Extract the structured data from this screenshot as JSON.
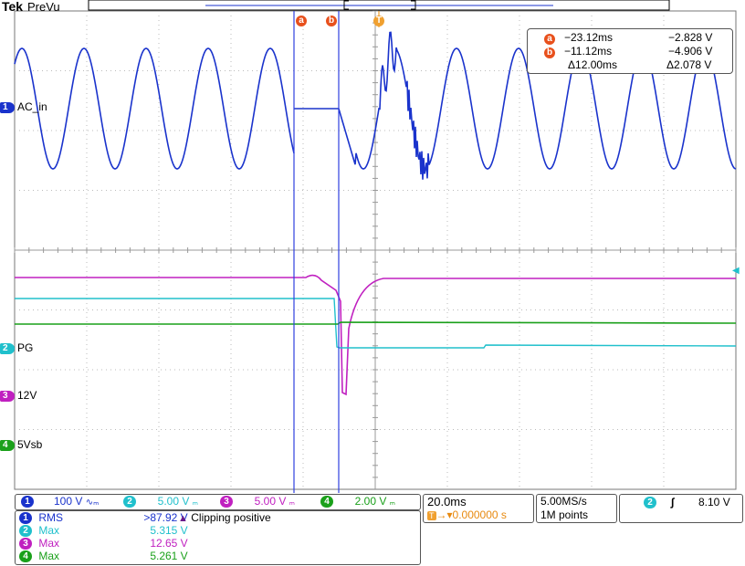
{
  "header": {
    "brand": "Tek",
    "mode": "PreVu"
  },
  "cursors": {
    "a": {
      "label": "a",
      "time": "−23.12ms",
      "volt": "−2.828 V"
    },
    "b": {
      "label": "b",
      "time": "−11.12ms",
      "volt": "−4.906 V"
    },
    "delta": {
      "time": "Δ12.00ms",
      "volt": "Δ2.078 V"
    }
  },
  "trigger_marker": "T",
  "channels": [
    {
      "num": "1",
      "name": "AC_in",
      "color": "#1a33cc",
      "scale": "100 V",
      "coupling": "∿ₘ"
    },
    {
      "num": "2",
      "name": "PG",
      "color": "#20c0cc",
      "scale": "5.00 V",
      "coupling": "ₘ"
    },
    {
      "num": "3",
      "name": "12V",
      "color": "#c020c0",
      "scale": "5.00 V",
      "coupling": "ₘ"
    },
    {
      "num": "4",
      "name": "5Vsb",
      "color": "#1aa01a",
      "scale": "2.00 V",
      "coupling": "ₘ"
    }
  ],
  "colors": {
    "ch1": "#1a33cc",
    "ch2": "#20c0cc",
    "ch3": "#c020c0",
    "ch4": "#1aa01a",
    "cursor": "#e8501c",
    "trigger": "#f0a030",
    "grid": "#888888"
  },
  "timebase": {
    "scale": "20.0ms",
    "trigger_pos": "0.000000 s",
    "sample_rate": "5.00MS/s",
    "record_length": "1M points"
  },
  "trigger": {
    "source": "2",
    "slope_icon": "rising-edge-icon",
    "level": "8.10 V"
  },
  "measurements": [
    {
      "ch": "1",
      "name": "RMS",
      "value": ">87.92 V"
    },
    {
      "ch": "2",
      "name": "Max",
      "value": "5.315 V"
    },
    {
      "ch": "3",
      "name": "Max",
      "value": "12.65 V"
    },
    {
      "ch": "4",
      "name": "Max",
      "value": "5.261 V"
    }
  ],
  "warning": "Clipping positive"
}
